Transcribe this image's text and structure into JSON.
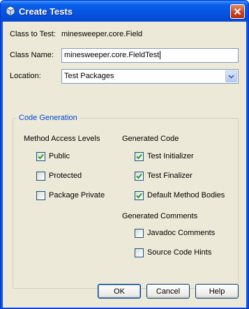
{
  "window": {
    "title": "Create Tests"
  },
  "form": {
    "class_to_test_label": "Class to Test:",
    "class_to_test_value": "minesweeper.core.Field",
    "class_name_label": "Class Name:",
    "class_name_value": "minesweeper.core.FieldTest",
    "location_label": "Location:",
    "location_value": "Test Packages"
  },
  "code_generation": {
    "title": "Code Generation",
    "method_access_levels": {
      "heading": "Method Access Levels",
      "items": [
        {
          "label": "Public",
          "checked": true
        },
        {
          "label": "Protected",
          "checked": false
        },
        {
          "label": "Package Private",
          "checked": false
        }
      ]
    },
    "generated_code": {
      "heading": "Generated Code",
      "items": [
        {
          "label": "Test Initializer",
          "checked": true
        },
        {
          "label": "Test Finalizer",
          "checked": true
        },
        {
          "label": "Default Method Bodies",
          "checked": true
        }
      ]
    },
    "generated_comments": {
      "heading": "Generated Comments",
      "items": [
        {
          "label": "Javadoc Comments",
          "checked": false
        },
        {
          "label": "Source Code Hints",
          "checked": false
        }
      ]
    }
  },
  "buttons": {
    "ok": "OK",
    "cancel": "Cancel",
    "help": "Help"
  },
  "colors": {
    "title_bar": "#0553e0",
    "dialog_bg": "#ece9d8",
    "group_title": "#0046d5",
    "check_mark": "#21a121"
  }
}
